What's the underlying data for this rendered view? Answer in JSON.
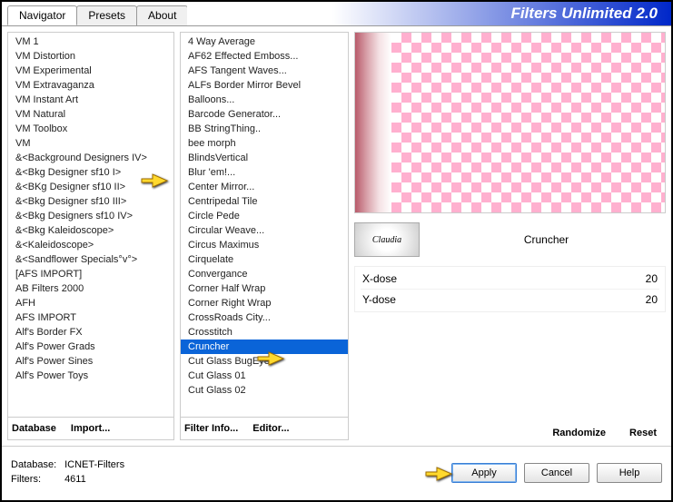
{
  "app_title": "Filters Unlimited 2.0",
  "tabs": {
    "navigator": "Navigator",
    "presets": "Presets",
    "about": "About"
  },
  "left_list": [
    "VM 1",
    "VM Distortion",
    "VM Experimental",
    "VM Extravaganza",
    "VM Instant Art",
    "VM Natural",
    "VM Toolbox",
    "VM",
    "&<Background Designers IV>",
    "&<Bkg Designer sf10 I>",
    "&<BKg Designer sf10 II>",
    "&<Bkg Designer sf10 III>",
    "&<Bkg Designers sf10 IV>",
    "&<Bkg Kaleidoscope>",
    "&<Kaleidoscope>",
    "&<Sandflower Specials°v°>",
    "[AFS IMPORT]",
    "AB Filters 2000",
    "AFH",
    "AFS IMPORT",
    "Alf's Border FX",
    "Alf's Power Grads",
    "Alf's Power Sines",
    "Alf's Power Toys"
  ],
  "left_foot": {
    "database": "Database",
    "import": "Import..."
  },
  "mid_list": [
    "4 Way Average",
    "AF62 Effected Emboss...",
    "AFS Tangent Waves...",
    "ALFs Border Mirror Bevel",
    "Balloons...",
    "Barcode Generator...",
    "BB StringThing..",
    "bee morph",
    "BlindsVertical",
    "Blur 'em!...",
    "Center Mirror...",
    "Centripedal Tile",
    "Circle Pede",
    "Circular Weave...",
    "Circus Maximus",
    "Cirquelate",
    "Convergance",
    "Corner Half Wrap",
    "Corner Right Wrap",
    "CrossRoads City...",
    "Crosstitch",
    "Cruncher",
    "Cut Glass  BugEye",
    "Cut Glass 01",
    "Cut Glass 02"
  ],
  "mid_selected_index": 21,
  "mid_foot": {
    "filter_info": "Filter Info...",
    "editor": "Editor..."
  },
  "badge_text": "Claudia",
  "filter_name": "Cruncher",
  "params": [
    {
      "label": "X-dose",
      "value": "20"
    },
    {
      "label": "Y-dose",
      "value": "20"
    }
  ],
  "right_foot": {
    "randomize": "Randomize",
    "reset": "Reset"
  },
  "database_info": {
    "db_label": "Database:",
    "db_value": "ICNET-Filters",
    "filters_label": "Filters:",
    "filters_value": "4611"
  },
  "buttons": {
    "apply": "Apply",
    "cancel": "Cancel",
    "help": "Help"
  }
}
